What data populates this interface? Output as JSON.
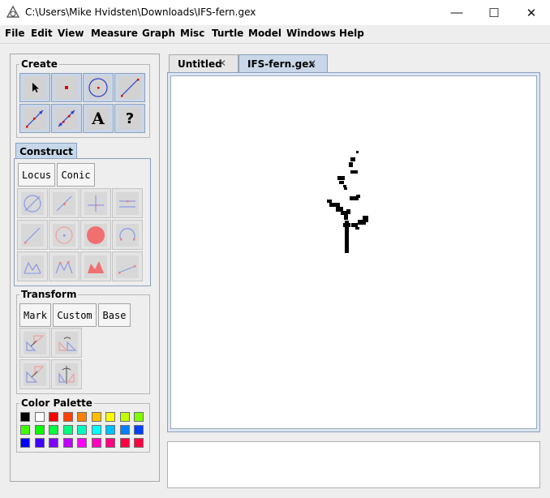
{
  "window": {
    "title": "C:\\Users\\Mike Hvidsten\\Downloads\\IFS-fern.gex",
    "minimize_glyph": "—",
    "maximize_glyph": "☐",
    "close_glyph": "✕"
  },
  "menu": [
    "File",
    "Edit",
    "View",
    "Measure",
    "Graph",
    "Misc",
    "Turtle",
    "Model",
    "Windows",
    "Help"
  ],
  "create": {
    "label": "Create",
    "tools": [
      "pointer-icon",
      "point-icon",
      "circle-icon",
      "segment-icon",
      "ray-icon",
      "line-icon",
      "text-tool-icon",
      "help-icon"
    ],
    "text_glyph": "A",
    "help_glyph": "?"
  },
  "construct": {
    "tab_label": "Construct",
    "buttons": [
      "Locus",
      "Conic"
    ],
    "tools": [
      "intersection-icon",
      "midpoint-icon",
      "perpendicular-icon",
      "parallel-icon",
      "bisector-icon",
      "circle-center-icon",
      "circle-interior-icon",
      "arc-icon",
      "polygon-icon",
      "sector-icon",
      "filled-polygon-icon",
      "measure-segment-icon"
    ]
  },
  "transform": {
    "label": "Transform",
    "buttons": [
      "Mark",
      "Custom",
      "Base"
    ],
    "tools": [
      "translate-icon",
      "rotate-icon",
      "dilate-icon",
      "reflect-icon"
    ]
  },
  "palette": {
    "label": "Color Palette",
    "colors": [
      "#000000",
      "#ffffff",
      "#ff0000",
      "#ff4000",
      "#ff8000",
      "#ffbf00",
      "#ffff00",
      "#bfff00",
      "#80ff00",
      "#40ff00",
      "#00ff00",
      "#00ff40",
      "#00ff80",
      "#00ffbf",
      "#00ffff",
      "#00bfff",
      "#0080ff",
      "#0040ff",
      "#0000ff",
      "#4000ff",
      "#8000ff",
      "#bf00ff",
      "#ff00ff",
      "#ff00bf",
      "#ff0080",
      "#ff0040",
      "#ff0040"
    ]
  },
  "tabs": [
    {
      "label": "Untitled",
      "close": "✕"
    },
    {
      "label": "IFS-fern.gex",
      "close": "✕"
    }
  ]
}
